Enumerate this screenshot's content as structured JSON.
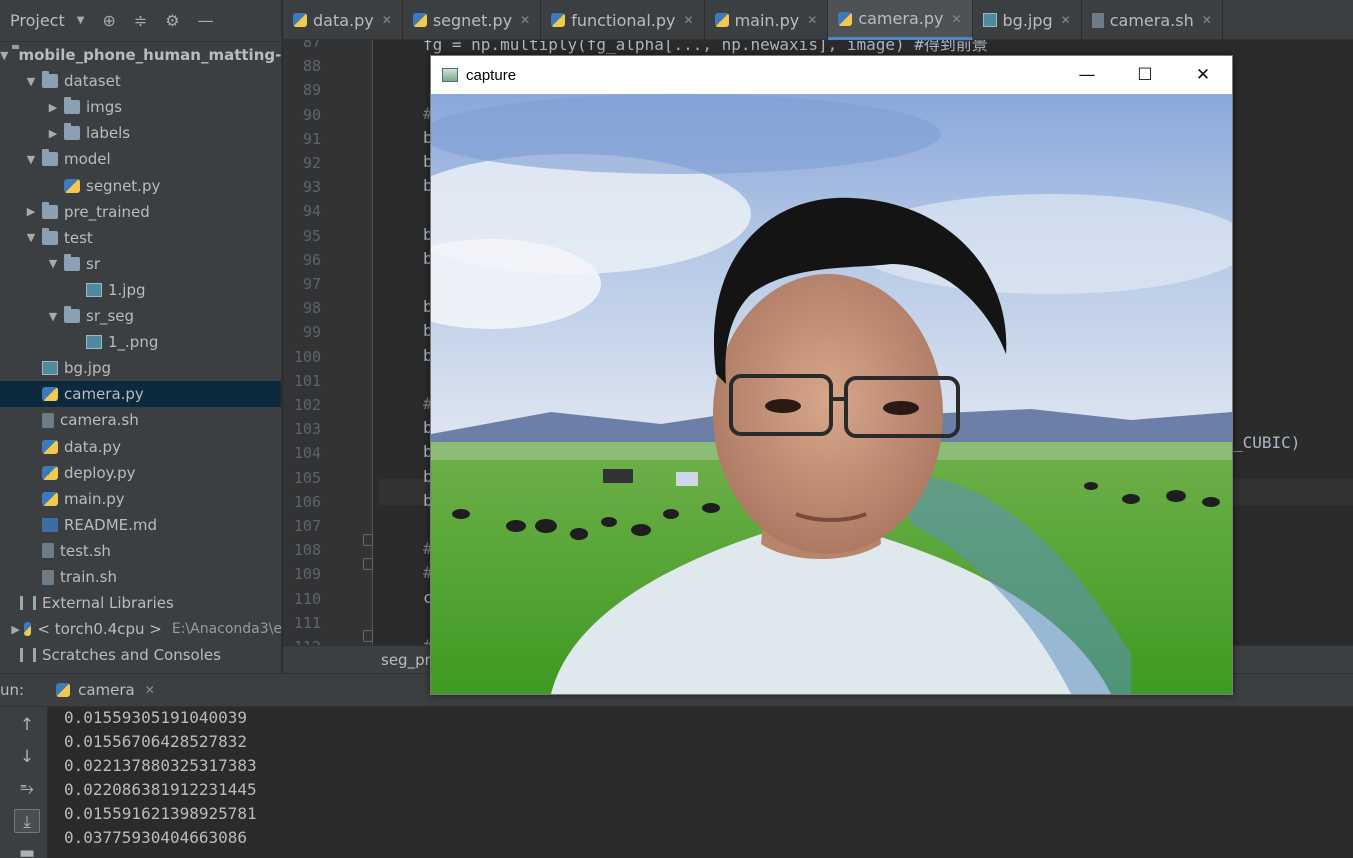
{
  "project": {
    "title": "Project",
    "tree": [
      {
        "label": "mobile_phone_human_matting-m",
        "kind": "folder",
        "indent": 0,
        "arrow": "▼",
        "bold": true
      },
      {
        "label": "dataset",
        "kind": "folder",
        "indent": 1,
        "arrow": "▼"
      },
      {
        "label": "imgs",
        "kind": "folder",
        "indent": 2,
        "arrow": "▶"
      },
      {
        "label": "labels",
        "kind": "folder",
        "indent": 2,
        "arrow": "▶"
      },
      {
        "label": "model",
        "kind": "folder",
        "indent": 1,
        "arrow": "▼"
      },
      {
        "label": "segnet.py",
        "kind": "py",
        "indent": 2,
        "arrow": ""
      },
      {
        "label": "pre_trained",
        "kind": "folder",
        "indent": 1,
        "arrow": "▶"
      },
      {
        "label": "test",
        "kind": "folder",
        "indent": 1,
        "arrow": "▼"
      },
      {
        "label": "sr",
        "kind": "folder",
        "indent": 2,
        "arrow": "▼"
      },
      {
        "label": "1.jpg",
        "kind": "img",
        "indent": 3,
        "arrow": ""
      },
      {
        "label": "sr_seg",
        "kind": "folder",
        "indent": 2,
        "arrow": "▼"
      },
      {
        "label": "1_.png",
        "kind": "img",
        "indent": 3,
        "arrow": ""
      },
      {
        "label": "bg.jpg",
        "kind": "img",
        "indent": 1,
        "arrow": ""
      },
      {
        "label": "camera.py",
        "kind": "py",
        "indent": 1,
        "arrow": "",
        "selected": true
      },
      {
        "label": "camera.sh",
        "kind": "file",
        "indent": 1,
        "arrow": ""
      },
      {
        "label": "data.py",
        "kind": "py",
        "indent": 1,
        "arrow": ""
      },
      {
        "label": "deploy.py",
        "kind": "py",
        "indent": 1,
        "arrow": ""
      },
      {
        "label": "main.py",
        "kind": "py",
        "indent": 1,
        "arrow": ""
      },
      {
        "label": "README.md",
        "kind": "md",
        "indent": 1,
        "arrow": ""
      },
      {
        "label": "test.sh",
        "kind": "file",
        "indent": 1,
        "arrow": ""
      },
      {
        "label": "train.sh",
        "kind": "file",
        "indent": 1,
        "arrow": ""
      },
      {
        "label": "External Libraries",
        "kind": "lib",
        "indent": 0,
        "arrow": ""
      },
      {
        "label": "< torch0.4cpu >",
        "kind": "py",
        "indent": 1,
        "arrow": "▶",
        "hint": "E:\\Anaconda3\\e"
      },
      {
        "label": "Scratches and Consoles",
        "kind": "scratch",
        "indent": 0,
        "arrow": ""
      }
    ]
  },
  "tabs": [
    {
      "label": "data.py",
      "kind": "py"
    },
    {
      "label": "segnet.py",
      "kind": "py"
    },
    {
      "label": "functional.py",
      "kind": "py"
    },
    {
      "label": "main.py",
      "kind": "py"
    },
    {
      "label": "camera.py",
      "kind": "py",
      "active": true
    },
    {
      "label": "bg.jpg",
      "kind": "img"
    },
    {
      "label": "camera.sh",
      "kind": "file"
    }
  ],
  "editor": {
    "line_numbers": [
      "87",
      "88",
      "89",
      "90",
      "91",
      "92",
      "93",
      "94",
      "95",
      "96",
      "97",
      "98",
      "99",
      "100",
      "101",
      "102",
      "103",
      "104",
      "105",
      "106",
      "107",
      "108",
      "109",
      "110",
      "111",
      "112"
    ],
    "top_line_text": "fg = np.multiply(fg_alpha[..., np.newaxis], image) #得到前景",
    "visible_fragments": [
      {
        "line": "90",
        "text": "#"
      },
      {
        "line": "91",
        "text": "b"
      },
      {
        "line": "92",
        "text": "b"
      },
      {
        "line": "93",
        "text": "b"
      },
      {
        "line": "95",
        "text": "b"
      },
      {
        "line": "96",
        "text": "b"
      },
      {
        "line": "98",
        "text": "b"
      },
      {
        "line": "99",
        "text": "b"
      },
      {
        "line": "100",
        "text": "b"
      },
      {
        "line": "102",
        "text": "#"
      },
      {
        "line": "103",
        "text": "b"
      },
      {
        "line": "104",
        "text": "b"
      },
      {
        "line": "105",
        "text": "b"
      },
      {
        "line": "106",
        "text": "b"
      },
      {
        "line": "108",
        "text": "#"
      },
      {
        "line": "109",
        "text": "#"
      },
      {
        "line": "110",
        "text": "c"
      },
      {
        "line": "112",
        "text": "#"
      }
    ],
    "right_fragment": "_CUBIC)",
    "breadcrumb": "seg_pr"
  },
  "run": {
    "label": "un:",
    "tab": "camera",
    "output": [
      "0.01559305191040039",
      "0.01556706428527832",
      "0.022137880325317383",
      "0.022086381912231445",
      "0.015591621398925781",
      "0.03775930404663086"
    ]
  },
  "capture": {
    "title": "capture",
    "minimize": "—",
    "maximize": "☐",
    "close": "✕"
  },
  "colors": {
    "accent": "#4a88c7",
    "selection": "#0d293e",
    "panel": "#3c3f41",
    "editor": "#2b2b2b"
  }
}
